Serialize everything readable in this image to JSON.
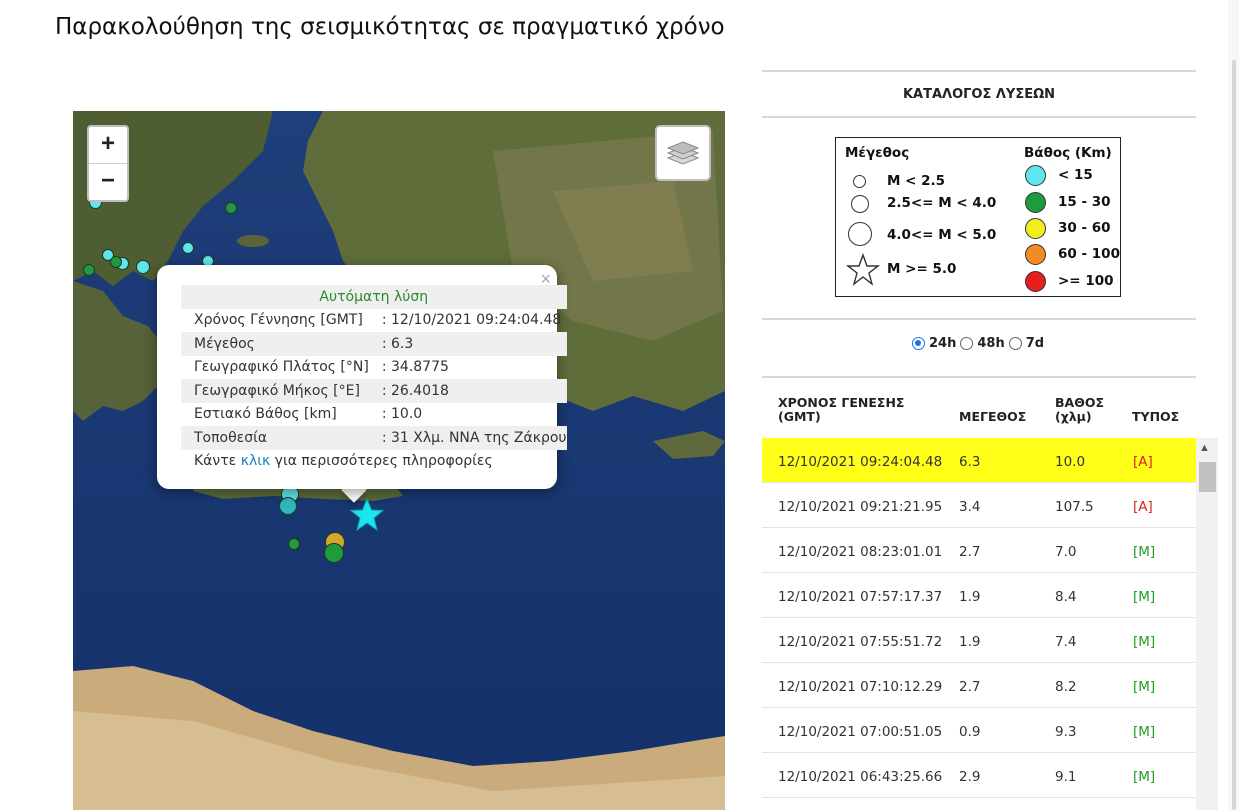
{
  "page_title": "Παρακολούθηση της σεισμικότητας σε πραγματικό χρόνο",
  "map": {
    "zoom_in": "+",
    "zoom_out": "−",
    "popup": {
      "heading": "Αυτόματη λύση",
      "close": "×",
      "rows": [
        {
          "label": "Χρόνος Γέννησης [GMT]",
          "value": ": 12/10/2021 09:24:04.48"
        },
        {
          "label": "Μέγεθος",
          "value": ": 6.3"
        },
        {
          "label": "Γεωγραφικό Πλάτος [°N]",
          "value": ": 34.8775"
        },
        {
          "label": "Γεωγραφικό Μήκος [°E]",
          "value": ": 26.4018"
        },
        {
          "label": "Εστιακό Βάθος [km]",
          "value": ": 10.0"
        },
        {
          "label": "Τοποθεσία",
          "value": ": 31 Χλμ. ΝΝΑ της Ζάκρου"
        }
      ],
      "more_prefix": "Κάντε ",
      "more_link": "κλικ",
      "more_suffix": " για περισσότερες πληροφορίες"
    }
  },
  "catalog": {
    "title": "ΚΑΤΑΛΟΓΟΣ ΛΥΣΕΩΝ",
    "legend": {
      "mag_title": "Μέγεθος",
      "mag_items": [
        "M < 2.5",
        "2.5<= M < 4.0",
        "4.0<= M < 5.0",
        "M >= 5.0"
      ],
      "depth_title": "Βάθος (Km)",
      "depth_items": [
        {
          "label": "< 15",
          "color": "#5fe6ec"
        },
        {
          "label": "15 - 30",
          "color": "#1f9a3c"
        },
        {
          "label": "30 - 60",
          "color": "#f2ee1c"
        },
        {
          "label": "60 - 100",
          "color": "#f48a24"
        },
        {
          "label": ">= 100",
          "color": "#e61e1e"
        }
      ]
    },
    "periods": [
      {
        "label": "24h",
        "selected": true
      },
      {
        "label": "48h",
        "selected": false
      },
      {
        "label": "7d",
        "selected": false
      }
    ],
    "headers": {
      "time_1": "ΧΡΟΝΟΣ ΓΕΝΕΣΗΣ",
      "time_2": "(GMT)",
      "mag": "ΜΕΓΕΘΟΣ",
      "depth_1": "ΒΑΘΟΣ",
      "depth_2": "(χλμ)",
      "type": "ΤΥΠΟΣ"
    },
    "rows": [
      {
        "time": "12/10/2021 09:24:04.48",
        "mag": "6.3",
        "depth": "10.0",
        "type": "[A]"
      },
      {
        "time": "12/10/2021 09:21:21.95",
        "mag": "3.4",
        "depth": "107.5",
        "type": "[A]"
      },
      {
        "time": "12/10/2021 08:23:01.01",
        "mag": "2.7",
        "depth": "7.0",
        "type": "[M]"
      },
      {
        "time": "12/10/2021 07:57:17.37",
        "mag": "1.9",
        "depth": "8.4",
        "type": "[M]"
      },
      {
        "time": "12/10/2021 07:55:51.72",
        "mag": "1.9",
        "depth": "7.4",
        "type": "[M]"
      },
      {
        "time": "12/10/2021 07:10:12.29",
        "mag": "2.7",
        "depth": "8.2",
        "type": "[M]"
      },
      {
        "time": "12/10/2021 07:00:51.05",
        "mag": "0.9",
        "depth": "9.3",
        "type": "[M]"
      },
      {
        "time": "12/10/2021 06:43:25.66",
        "mag": "2.9",
        "depth": "9.1",
        "type": "[M]"
      }
    ]
  },
  "colors": {
    "highlight_row": "#ffff1a",
    "type_auto": "#e02020",
    "type_manual": "#20a020",
    "radio_accent": "#1a73e8",
    "star_marker": "#19e6ee"
  }
}
